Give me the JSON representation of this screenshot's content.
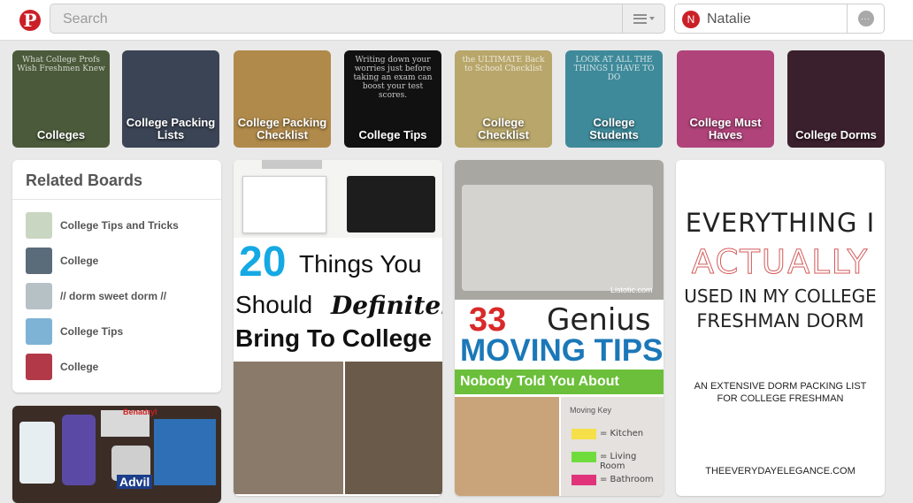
{
  "header": {
    "logo_letter": "P",
    "search_placeholder": "Search",
    "user_name": "Natalie",
    "user_avatar_letter": "N",
    "messages_icon": "..."
  },
  "guided_search": [
    {
      "label": "Colleges",
      "color": "#4a5a3a",
      "img_text": "What College Profs Wish Freshmen Knew"
    },
    {
      "label": "College Packing Lists",
      "color": "#3b4455",
      "img_text": ""
    },
    {
      "label": "College Packing Checklist",
      "color": "#b08a4a",
      "img_text": ""
    },
    {
      "label": "College Tips",
      "color": "#111111",
      "img_text": "Writing down your worries just before taking an exam can boost your test scores."
    },
    {
      "label": "College Checklist",
      "color": "#b8a66a",
      "img_text": "the ULTIMATE Back to School Checklist"
    },
    {
      "label": "College Students",
      "color": "#3f8a9a",
      "img_text": "LOOK AT ALL THE THINGS I HAVE TO DO"
    },
    {
      "label": "College Must Haves",
      "color": "#b0437a",
      "img_text": ""
    },
    {
      "label": "College Dorms",
      "color": "#3a1f2c",
      "img_text": ""
    }
  ],
  "related_boards": {
    "title": "Related Boards",
    "items": [
      {
        "label": "College Tips and Tricks",
        "color": "#c9d6c2"
      },
      {
        "label": "College",
        "color": "#5a6b7a"
      },
      {
        "label": "// dorm sweet dorm //",
        "color": "#b6c1c6"
      },
      {
        "label": "College Tips",
        "color": "#7fb3d6"
      },
      {
        "label": "College",
        "color": "#b23a48"
      }
    ]
  },
  "pins": {
    "pin1": {
      "number": "20",
      "line1": "Things You",
      "line2a": "Should",
      "line2b": "Definitely",
      "line3": "Bring To College"
    },
    "pin2": {
      "watermark": "Listotic.com",
      "number": "33",
      "word": "Genius",
      "line2": "MOVING TIPS",
      "line3": "Nobody Told You About",
      "note_title": "Moving Key",
      "note1": "= Kitchen",
      "note2": "= Living Room",
      "note3": "= Bathroom"
    },
    "pin3": {
      "line1": "EVERYTHING I",
      "line2": "ACTUALLY",
      "line3": "USED IN MY COLLEGE",
      "line4": "FRESHMAN DORM",
      "sub1": "AN EXTENSIVE DORM PACKING LIST",
      "sub2": "FOR COLLEGE FRESHMAN",
      "site": "THEEVERYDAYELEGANCE.COM"
    },
    "pin4": {
      "brand1": "Benadryl",
      "brand2": "Advil"
    }
  }
}
